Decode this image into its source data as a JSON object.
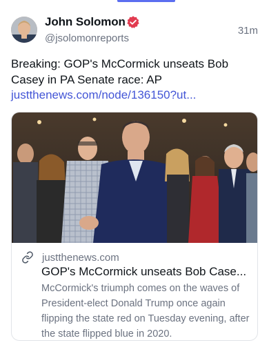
{
  "post": {
    "author_name": "John Solomon",
    "handle": "@jsolomonreports",
    "timestamp": "31m",
    "text": "Breaking: GOP's McCormick unseats Bob Casey in PA Senate race: AP",
    "link_text": "justthenews.com/node/136150?ut..."
  },
  "card": {
    "domain": "justthenews.com",
    "title": "GOP's McCormick unseats Bob Case...",
    "description": "McCormick's triumph comes on the waves of President-elect Donald Trump once again flipping the state red on Tuesday evening, after the state flipped blue in 2020."
  },
  "colors": {
    "accent": "#4355d6",
    "verified_badge": "#e23b50",
    "indicator": "#5b6ef0"
  },
  "icons": {
    "verified": "verified-badge-icon",
    "link": "link-icon"
  }
}
